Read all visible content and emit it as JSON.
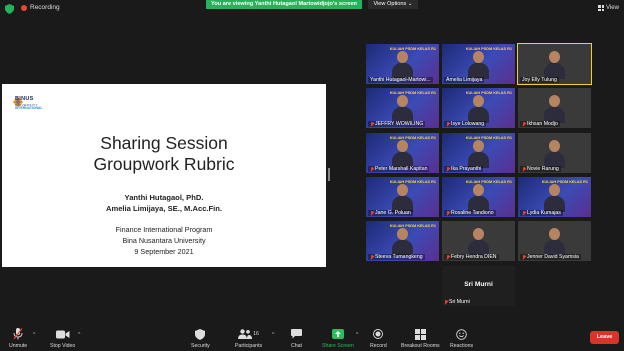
{
  "topbar": {
    "recording_label": "Recording",
    "banner_text": "You are viewing Yanthi Hutagaol Martowidjojo's screen",
    "view_options_label": "View Options",
    "view_label": "View"
  },
  "slide": {
    "logo_name": "BINUS",
    "logo_sub": "UNIVERSITY",
    "logo_intl": "INTERNATIONAL",
    "title_line1": "Sharing Session",
    "title_line2": "Groupwork Rubric",
    "author1": "Yanthi Hutagaol, PhD.",
    "author2": "Amelia Limijaya, SE., M.Acc.Fin.",
    "org1": "Finance International Program",
    "org2": "Bina Nusantara University",
    "date": "9 September 2021"
  },
  "participants": {
    "kuliah_text": "KULIAH PSDM KELAS R1",
    "tiles": [
      {
        "name": "Yanthi Hutagaol-Martowi...",
        "muted": false,
        "style": "kul",
        "active": false
      },
      {
        "name": "Amelia Limijaya",
        "muted": false,
        "style": "kul",
        "active": false
      },
      {
        "name": "Joy Elly Tulung",
        "muted": false,
        "style": "plain",
        "active": true
      },
      {
        "name": "JEFFRY WOWILING",
        "muted": true,
        "style": "kul",
        "active": false
      },
      {
        "name": "Isye Lolowang",
        "muted": true,
        "style": "kul",
        "active": false
      },
      {
        "name": "Ikhsan Modjo",
        "muted": true,
        "style": "plain",
        "active": false
      },
      {
        "name": "Peter Marshall Kapitan",
        "muted": true,
        "style": "kul",
        "active": false
      },
      {
        "name": "Ika Prayanthi",
        "muted": true,
        "style": "kul",
        "active": false
      },
      {
        "name": "Novie Rarung",
        "muted": true,
        "style": "plain",
        "active": false
      },
      {
        "name": "Jane G. Poluan",
        "muted": true,
        "style": "kul",
        "active": false
      },
      {
        "name": "Rosaline Tandiono",
        "muted": true,
        "style": "kul",
        "active": false
      },
      {
        "name": "Lydia Kumajas",
        "muted": true,
        "style": "kul",
        "active": false
      },
      {
        "name": "Steeva Tumangkeng",
        "muted": true,
        "style": "kul",
        "active": false
      },
      {
        "name": "Febry Hendra DIEN",
        "muted": true,
        "style": "plain",
        "active": false
      },
      {
        "name": "Jenner David Syamsia",
        "muted": true,
        "style": "plain",
        "active": false
      }
    ],
    "sri": {
      "big_name": "Sri Murni",
      "name": "Sri Murni"
    }
  },
  "toolbar": {
    "unmute": "Unmute",
    "stop_video": "Stop Video",
    "security": "Security",
    "participants": "Participants",
    "participants_count": "16",
    "chat": "Chat",
    "share_screen": "Share Screen",
    "record": "Record",
    "breakout": "Breakout Rooms",
    "reactions": "Reactions",
    "leave": "Leave"
  },
  "colors": {
    "banner": "#23b35a",
    "leave": "#d9332a",
    "active_border": "#f2d22a"
  }
}
